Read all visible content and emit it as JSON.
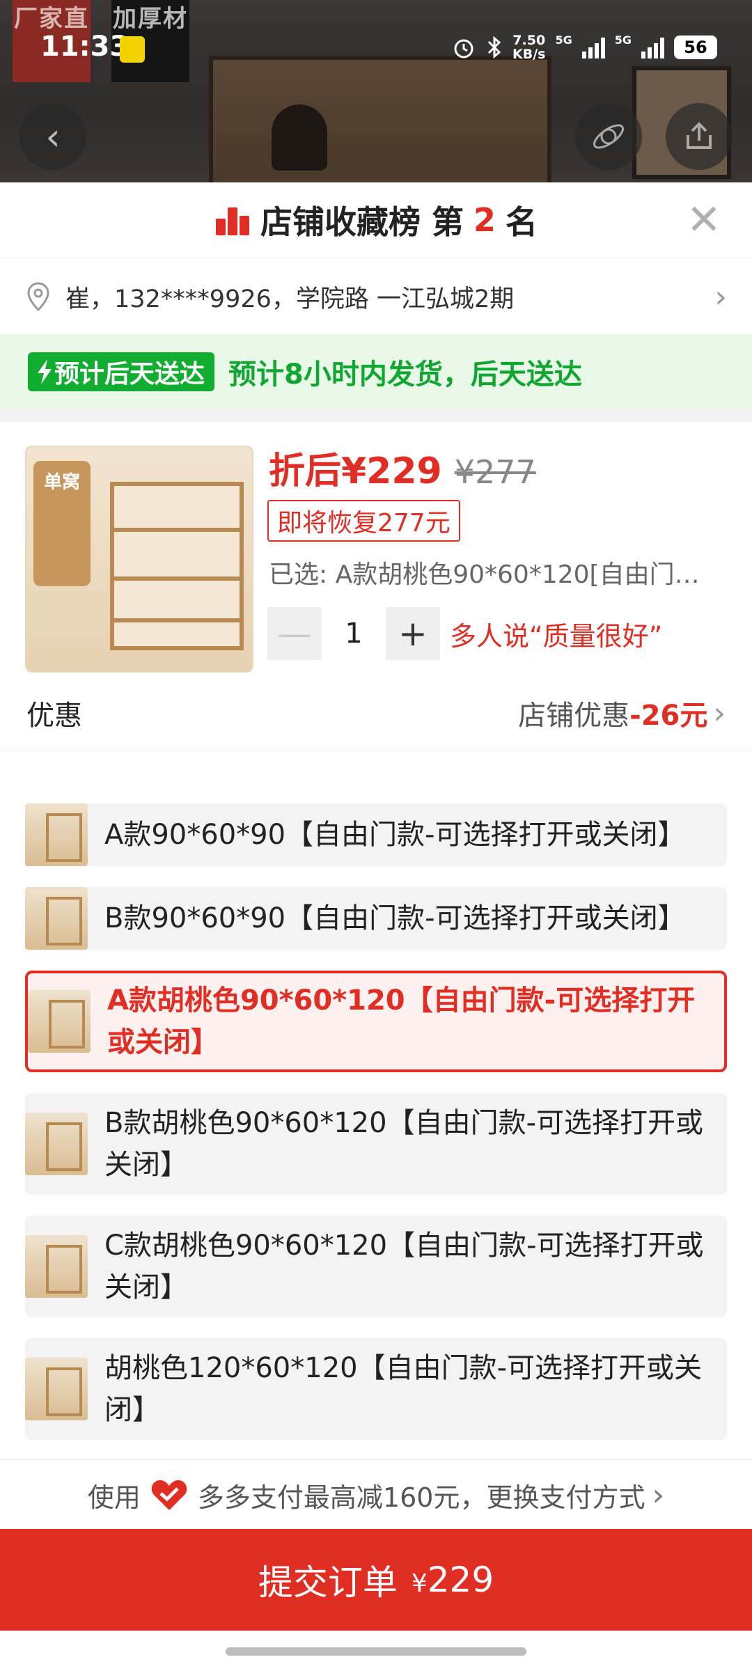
{
  "status_bar": {
    "time": "11:33",
    "net_speed_value": "7.50",
    "net_speed_unit": "KB/s",
    "signal_1_label": "5G",
    "signal_2_label": "5G",
    "battery": "56"
  },
  "hero": {
    "ribbon_1": "厂家直",
    "ribbon_2": "加厚材"
  },
  "rank": {
    "prefix": "店铺收藏榜 第",
    "number": "2",
    "suffix": "名"
  },
  "address": {
    "text": "崔，132****9926，学院路 一江弘城2期"
  },
  "delivery": {
    "badge": "预计后天送达",
    "text": "预计8小时内发货，后天送达"
  },
  "product": {
    "thumb_tag": "单窝",
    "price_now": "折后¥229",
    "price_orig": "¥277",
    "restore_tag": "即将恢复277元",
    "selected": "已选: A款胡桃色90*60*120[自由门…",
    "quantity": "1",
    "praise": "多人说“质量很好”"
  },
  "discount": {
    "label": "优惠",
    "store_label": "店铺优惠",
    "amount": "-26元"
  },
  "options": [
    {
      "label": "A款90*60*90【自由门款-可选择打开或关闭】"
    },
    {
      "label": "B款90*60*90【自由门款-可选择打开或关闭】"
    },
    {
      "label": "A款胡桃色90*60*120【自由门款-可选择打开或关闭】"
    },
    {
      "label": "B款胡桃色90*60*120【自由门款-可选择打开或关闭】"
    },
    {
      "label": "C款胡桃色90*60*120【自由门款-可选择打开或关闭】"
    },
    {
      "label": "胡桃色120*60*120【自由门款-可选择打开或关闭】"
    }
  ],
  "selected_option_index": 2,
  "payment": {
    "prefix": "使用",
    "text": "多多支付最高减160元，更换支付方式"
  },
  "submit": {
    "label": "提交订单",
    "currency": "¥",
    "amount": "229"
  },
  "colors": {
    "accent_red": "#e02e24",
    "delivery_green": "#10ad30",
    "delivery_bg": "#e8f9e8"
  }
}
